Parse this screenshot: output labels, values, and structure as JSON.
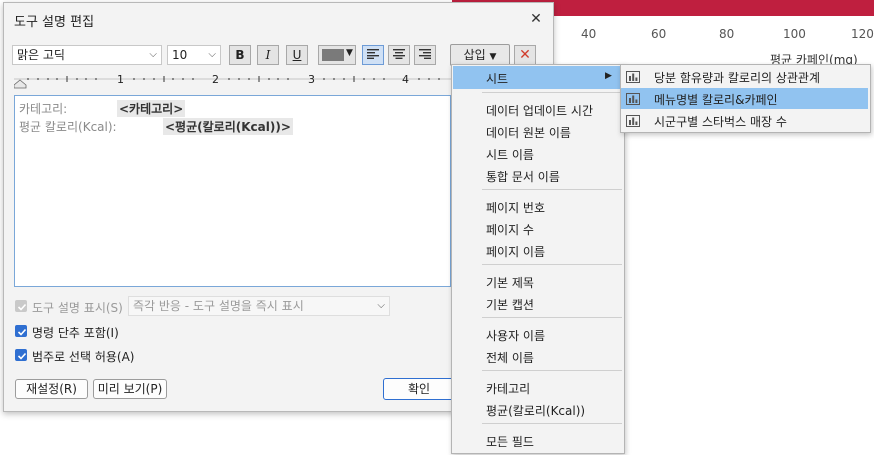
{
  "background": {
    "axis_ticks": [
      "40",
      "60",
      "80",
      "100",
      "120"
    ],
    "axis_title": "평균 카페인(mg)",
    "accent_color": "#bf1f3f"
  },
  "dialog": {
    "title": "도구 설명 편집",
    "toolbar": {
      "font_family": "맑은 고딕",
      "font_size": "10",
      "bold_label": "B",
      "italic_label": "I",
      "underline_label": "U",
      "insert_label": "삽입",
      "ruler_numbers": [
        "1",
        "2",
        "3",
        "4"
      ]
    },
    "editor": {
      "lines": [
        {
          "label": "카테고리:",
          "tag": "<카테고리>"
        },
        {
          "label": "평균 칼로리(Kcal):",
          "tag": "<평균(칼로리(Kcal))>"
        }
      ]
    },
    "options": {
      "show_tooltip_label": "도구 설명 표시(S)",
      "show_tooltip_mode": "즉각 반응 - 도구 설명을 즉시 표시",
      "include_command_buttons_label": "명령 단추 포함(I)",
      "allow_category_select_label": "범주로 선택 허용(A)"
    },
    "buttons": {
      "reset": "재설정(R)",
      "preview": "미리 보기(P)",
      "ok": "확인"
    }
  },
  "insert_menu": {
    "sheet_item": "시트",
    "groups": [
      [
        "데이터 업데이트 시간",
        "데이터 원본 이름",
        "시트 이름",
        "통합 문서 이름"
      ],
      [
        "페이지 번호",
        "페이지 수",
        "페이지 이름"
      ],
      [
        "기본 제목",
        "기본 캡션"
      ],
      [
        "사용자 이름",
        "전체 이름"
      ],
      [
        "카테고리",
        "평균(칼로리(Kcal))"
      ],
      [
        "모든 필드"
      ]
    ]
  },
  "sheets_submenu": {
    "items": [
      {
        "label": "당분 함유량과 칼로리의 상관관계",
        "icon": "bar-chart-icon"
      },
      {
        "label": "메뉴명별 칼로리&카페인",
        "icon": "bar-chart-icon",
        "highlighted": true
      },
      {
        "label": "시군구별 스타벅스 매장 수",
        "icon": "bar-chart-icon"
      }
    ]
  }
}
